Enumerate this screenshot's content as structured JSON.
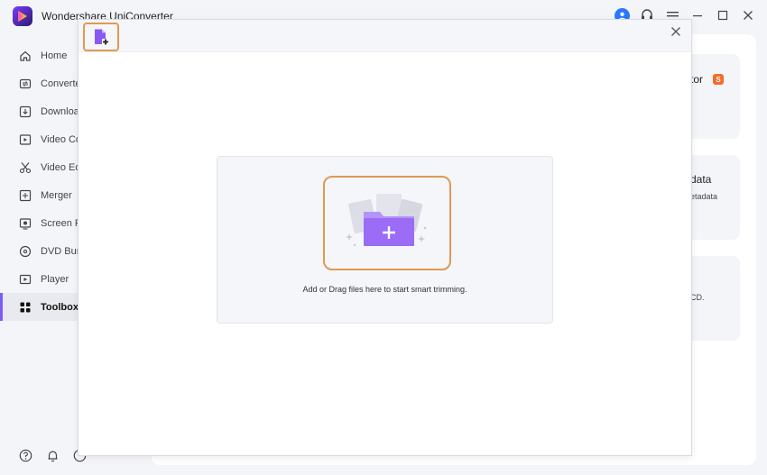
{
  "app": {
    "title": "Wondershare UniConverter"
  },
  "sidebar": {
    "items": [
      {
        "label": "Home",
        "icon": "home-icon"
      },
      {
        "label": "Converter",
        "icon": "convert-icon"
      },
      {
        "label": "Downloader",
        "icon": "download-icon"
      },
      {
        "label": "Video Compressor",
        "icon": "compress-icon"
      },
      {
        "label": "Video Editor",
        "icon": "scissors-icon"
      },
      {
        "label": "Merger",
        "icon": "merge-icon"
      },
      {
        "label": "Screen Recorder",
        "icon": "record-icon"
      },
      {
        "label": "DVD Burner",
        "icon": "disc-icon"
      },
      {
        "label": "Player",
        "icon": "play-icon"
      },
      {
        "label": "Toolbox",
        "icon": "grid-icon",
        "active": true
      }
    ]
  },
  "background_cards": [
    {
      "title": "tor",
      "badge": "S"
    },
    {
      "title": "data",
      "subtitle": "etadata"
    },
    {
      "title": "",
      "subtitle": "CD."
    }
  ],
  "modal": {
    "drop_hint": "Add or Drag files here to start smart trimming."
  },
  "colors": {
    "accent": "#7b5cf7",
    "highlight": "#e09a52",
    "badge": "#f56b2a",
    "user": "#2a78ff"
  }
}
